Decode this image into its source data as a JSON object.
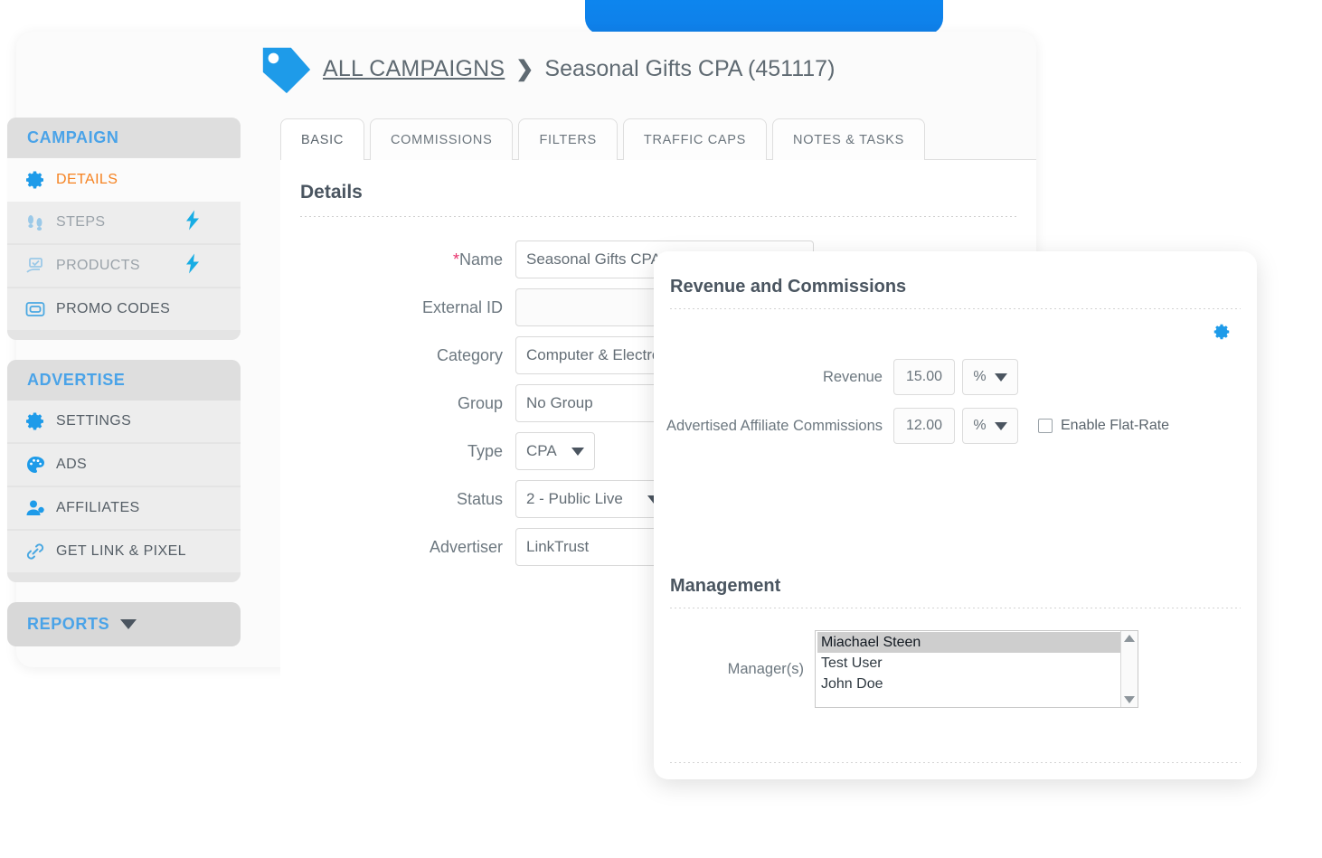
{
  "breadcrumb": {
    "icon": "tag-icon",
    "link": "ALL CAMPAIGNS",
    "separator": "❯",
    "current": "Seasonal Gifts CPA (451117)"
  },
  "sidebar": {
    "groups": [
      {
        "title": "CAMPAIGN",
        "items": [
          {
            "label": "DETAILS",
            "icon": "gear-icon",
            "active": true,
            "bolt": false
          },
          {
            "label": "STEPS",
            "icon": "footsteps-icon",
            "active": false,
            "bolt": true
          },
          {
            "label": "PRODUCTS",
            "icon": "product-hand-icon",
            "active": false,
            "bolt": true
          },
          {
            "label": "PROMO CODES",
            "icon": "promo-code-icon",
            "active": false,
            "bolt": false
          }
        ]
      },
      {
        "title": "ADVERTISE",
        "items": [
          {
            "label": "SETTINGS",
            "icon": "gear-icon",
            "active": false,
            "bolt": false
          },
          {
            "label": "ADS",
            "icon": "palette-icon",
            "active": false,
            "bolt": false
          },
          {
            "label": "AFFILIATES",
            "icon": "user-add-icon",
            "active": false,
            "bolt": false
          },
          {
            "label": "GET LINK & PIXEL",
            "icon": "link-icon",
            "active": false,
            "bolt": false
          }
        ]
      }
    ],
    "reports": {
      "label": "REPORTS",
      "icon": "caret-down-icon"
    }
  },
  "tabs": [
    {
      "label": "BASIC",
      "active": true
    },
    {
      "label": "COMMISSIONS",
      "active": false
    },
    {
      "label": "FILTERS",
      "active": false
    },
    {
      "label": "TRAFFIC CAPS",
      "active": false
    },
    {
      "label": "NOTES & TASKS",
      "active": false
    }
  ],
  "details": {
    "heading": "Details",
    "fields": [
      {
        "label": "Name",
        "required": true,
        "value": "Seasonal Gifts CPA",
        "type": "text",
        "placeholder": ""
      },
      {
        "label": "External ID",
        "required": false,
        "value": "",
        "type": "text",
        "placeholder": ""
      },
      {
        "label": "Category",
        "required": false,
        "value": "Computer & Electronics",
        "type": "text",
        "placeholder": ""
      },
      {
        "label": "Group",
        "required": false,
        "value": "No Group",
        "type": "text",
        "placeholder": ""
      },
      {
        "label": "Type",
        "required": false,
        "value": "CPA",
        "type": "select-small"
      },
      {
        "label": "Status",
        "required": false,
        "value": "2 - Public Live",
        "type": "select-med"
      },
      {
        "label": "Advertiser",
        "required": false,
        "value": "LinkTrust",
        "type": "select-wide"
      }
    ]
  },
  "overlay": {
    "revenue_section": {
      "title": "Revenue and Commissions",
      "gear_icon": "gear-icon",
      "rows": [
        {
          "label": "Revenue",
          "value": "15.00",
          "unit": "%",
          "flat_rate": null
        },
        {
          "label": "Advertised Affiliate Commissions",
          "value": "12.00",
          "unit": "%",
          "flat_rate": "Enable Flat-Rate"
        }
      ]
    },
    "management_section": {
      "title": "Management",
      "field_label": "Manager(s)",
      "managers": [
        {
          "name": "Miachael Steen",
          "selected": true
        },
        {
          "name": "Test User",
          "selected": false
        },
        {
          "name": "John Doe",
          "selected": false
        }
      ],
      "scroll_up_icon": "arrow-up-icon",
      "scroll_down_icon": "arrow-down-icon"
    }
  },
  "colors": {
    "accent_blue": "#1E9BE9",
    "ribbon_blue": "#0a8cf5",
    "ribbon_cyan": "#17c0f0",
    "active_orange": "#f58220",
    "required_pink": "#e8336d",
    "header_blue": "#4aa3e8",
    "text_gray": "#6d7880"
  }
}
